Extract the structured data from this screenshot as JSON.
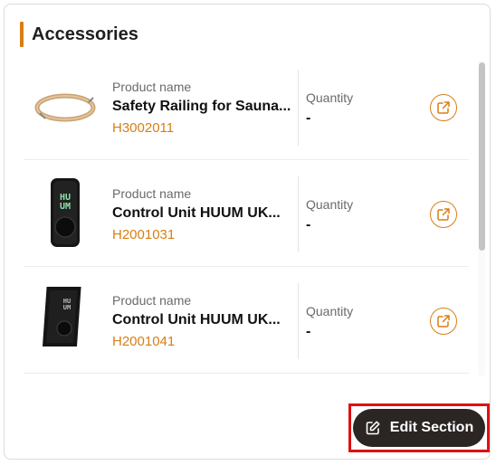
{
  "section": {
    "title": "Accessories"
  },
  "labels": {
    "product_name": "Product name",
    "quantity": "Quantity"
  },
  "products": [
    {
      "name": "Safety Railing for Sauna...",
      "code": "H3002011",
      "quantity": "-",
      "image": "railing-image"
    },
    {
      "name": "Control Unit HUUM UK...",
      "code": "H2001031",
      "quantity": "-",
      "image": "control-unit-image"
    },
    {
      "name": "Control Unit HUUM UK...",
      "code": "H2001041",
      "quantity": "-",
      "image": "control-unit-image"
    }
  ],
  "actions": {
    "edit_section": "Edit Section",
    "edit_icon": "edit-icon",
    "open_icon": "external-link-icon"
  },
  "colors": {
    "accent": "#d97d13",
    "button_bg": "#2b2523",
    "highlight": "#e01010"
  }
}
